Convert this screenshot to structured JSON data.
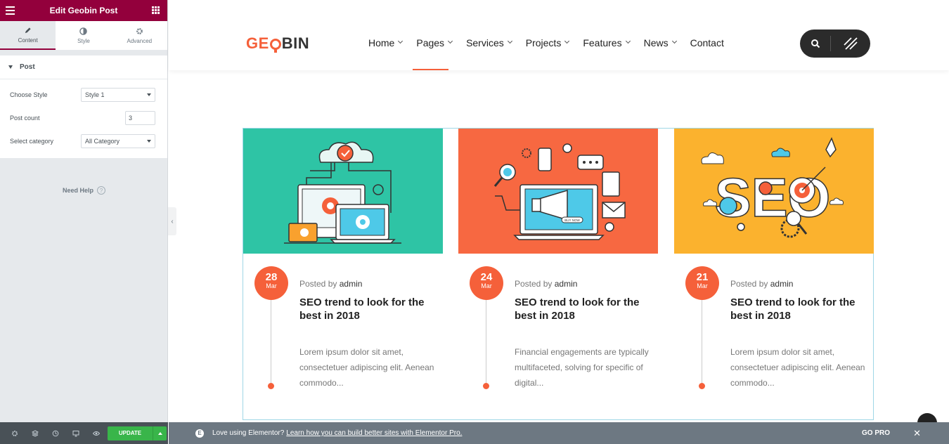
{
  "panel": {
    "title": "Edit Geobin Post",
    "tabs": [
      {
        "label": "Content",
        "icon": "pencil-icon"
      },
      {
        "label": "Style",
        "icon": "half-circle-icon"
      },
      {
        "label": "Advanced",
        "icon": "gear-icon"
      }
    ],
    "section": "Post",
    "controls": {
      "style_label": "Choose Style",
      "style_value": "Style 1",
      "count_label": "Post count",
      "count_value": "3",
      "category_label": "Select category",
      "category_value": "All Category"
    },
    "help": "Need Help",
    "help_glyph": "?",
    "collapse_glyph": "‹",
    "update_label": "UPDATE"
  },
  "site": {
    "logo": {
      "g": "GE",
      "rest": "BIN"
    },
    "nav": [
      {
        "label": "Home",
        "dropdown": true
      },
      {
        "label": "Pages",
        "dropdown": true
      },
      {
        "label": "Services",
        "dropdown": true
      },
      {
        "label": "Projects",
        "dropdown": true
      },
      {
        "label": "Features",
        "dropdown": true
      },
      {
        "label": "News",
        "dropdown": true
      },
      {
        "label": "Contact",
        "dropdown": false
      }
    ],
    "active_nav": "Pages",
    "accent": "#f5603a"
  },
  "posts": [
    {
      "day": "28",
      "month": "Mar",
      "posted_prefix": "Posted by",
      "author": "admin",
      "title": "SEO trend to look for the best in 2018",
      "excerpt": "Lorem ipsum dolor sit amet, consectetuer adipiscing elit. Aenean commodo...",
      "bg": "#2ec4a5",
      "image": "devices-illustration"
    },
    {
      "day": "24",
      "month": "Mar",
      "posted_prefix": "Posted by",
      "author": "admin",
      "title": "SEO trend to look for the best in 2018",
      "excerpt": "Financial engagements are typically multifaceted, solving for specific of digital...",
      "bg": "#f76841",
      "image": "marketing-illustration",
      "badge": "BUY NOW"
    },
    {
      "day": "21",
      "month": "Mar",
      "posted_prefix": "Posted by",
      "author": "admin",
      "title": "SEO trend to look for the best in 2018",
      "excerpt": "Lorem ipsum dolor sit amet, consectetuer adipiscing elit. Aenean commodo...",
      "bg": "#fbb22e",
      "image": "seo-illustration",
      "word": "SEO"
    }
  ],
  "promo": {
    "text": "Love using Elementor?",
    "link": "Learn how you can build better sites with Elementor Pro.",
    "go_pro": "GO PRO",
    "badge": "E",
    "close": "✕"
  }
}
